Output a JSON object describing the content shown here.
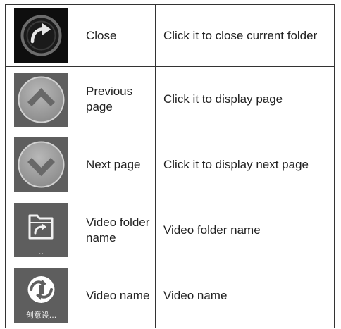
{
  "rows": [
    {
      "icon": "close-return-icon",
      "name": "Close",
      "description": "Click it to close current folder"
    },
    {
      "icon": "chevron-up-icon",
      "name": "Previous page",
      "description": "Click it to display page"
    },
    {
      "icon": "chevron-down-icon",
      "name": "Next page",
      "description": "Click it to display next page"
    },
    {
      "icon": "video-folder-icon",
      "name": "Video folder name",
      "icon_caption": "..",
      "description": "Video folder name"
    },
    {
      "icon": "video-file-icon",
      "name": "Video name",
      "icon_caption": "创意设...",
      "description": "Video name"
    }
  ]
}
